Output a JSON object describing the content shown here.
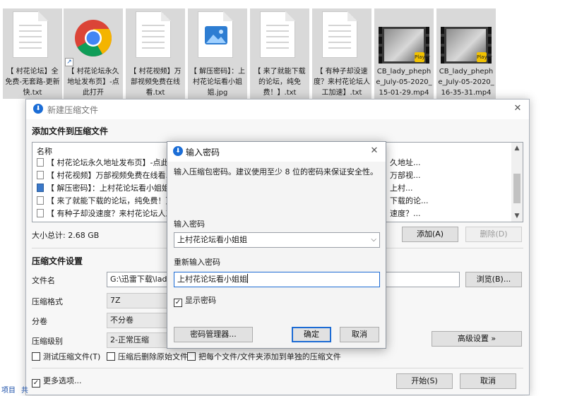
{
  "file_manager": {
    "items": [
      {
        "name": "【 村花论坛】全免费-无套路-更新快.txt",
        "icon": "text-file-icon"
      },
      {
        "name": "【 村花论坛永久地址发布页】-点此打开",
        "icon": "chrome-shortcut-icon"
      },
      {
        "name": "【 村花视频】万部视频免费在线看.txt",
        "icon": "text-file-icon"
      },
      {
        "name": "【 解压密码】：上村花论坛看小姐姐.jpg",
        "icon": "image-file-icon"
      },
      {
        "name": "【 来了就能下载的论坛，纯免费！】.txt",
        "icon": "text-file-icon"
      },
      {
        "name": "【 有种子却没速度？来村花论坛人工加速】.txt",
        "icon": "text-file-icon"
      },
      {
        "name": "CB_lady_phephe_July-05-2020_15-01-29.mp4",
        "icon": "video-file-icon"
      },
      {
        "name": "CB_lady_phephe_July-05-2020_16-35-31.mp4",
        "icon": "video-file-icon"
      }
    ],
    "badge_label": "Player",
    "shortcut_arrow": "↗"
  },
  "main_window": {
    "title": "新建压缩文件",
    "section_add": "添加文件到压缩文件",
    "list_header": "名称",
    "list_rows": [
      {
        "left": "【 村花论坛永久地址发布页】-点此打开",
        "right": "久地址..."
      },
      {
        "left": "【 村花视频】万部视频免费在线看.txt",
        "right": "万部视..."
      },
      {
        "left": "【 解压密码】：上村花论坛看小姐姐.jpg",
        "right": "上村..."
      },
      {
        "left": "【 来了就能下载的论坛，纯免费！】.txt",
        "right": "下载的论..."
      },
      {
        "left": "【 有种子却没速度？来村花论坛人工加速",
        "right": "速度？..."
      }
    ],
    "total_size": "大小总计: 2.68 GB",
    "add_button": "添加(A)",
    "delete_button": "删除(D)",
    "section_settings": "压缩文件设置",
    "filename_label": "文件名",
    "filename_value": "G:\\迅雷下载\\lady p",
    "browse_button": "浏览(B)...",
    "format_label": "压缩格式",
    "format_value": "7Z",
    "volume_label": "分卷",
    "volume_value": "不分卷",
    "level_label": "压缩级别",
    "level_value": "2-正常压缩",
    "advanced_button": "高级设置 »",
    "opt_test": "测试压缩文件(T)",
    "opt_delete": "压缩后删除原始文件",
    "opt_each": "把每个文件/文件夹添加到单独的压缩文件",
    "more_options": "更多选项...",
    "start_button": "开始(S)",
    "cancel_button": "取消"
  },
  "password_dialog": {
    "title": "输入密码",
    "hint": "输入压缩包密码。建议使用至少 8 位的密码来保证安全性。",
    "enter_label": "输入密码",
    "enter_value": "上村花论坛看小姐姐",
    "reenter_label": "重新输入密码",
    "reenter_value": "上村花论坛看小姐姐",
    "show_password": "显示密码",
    "show_password_checked": true,
    "manager_button": "密码管理器...",
    "ok_button": "确定",
    "cancel_button": "取消"
  },
  "bottom_edge": {
    "left_fragment": "项目",
    "second_fragment": "共"
  },
  "colors": {
    "accent": "#1c6bd4",
    "selection_gray": "#d9d9d9"
  }
}
